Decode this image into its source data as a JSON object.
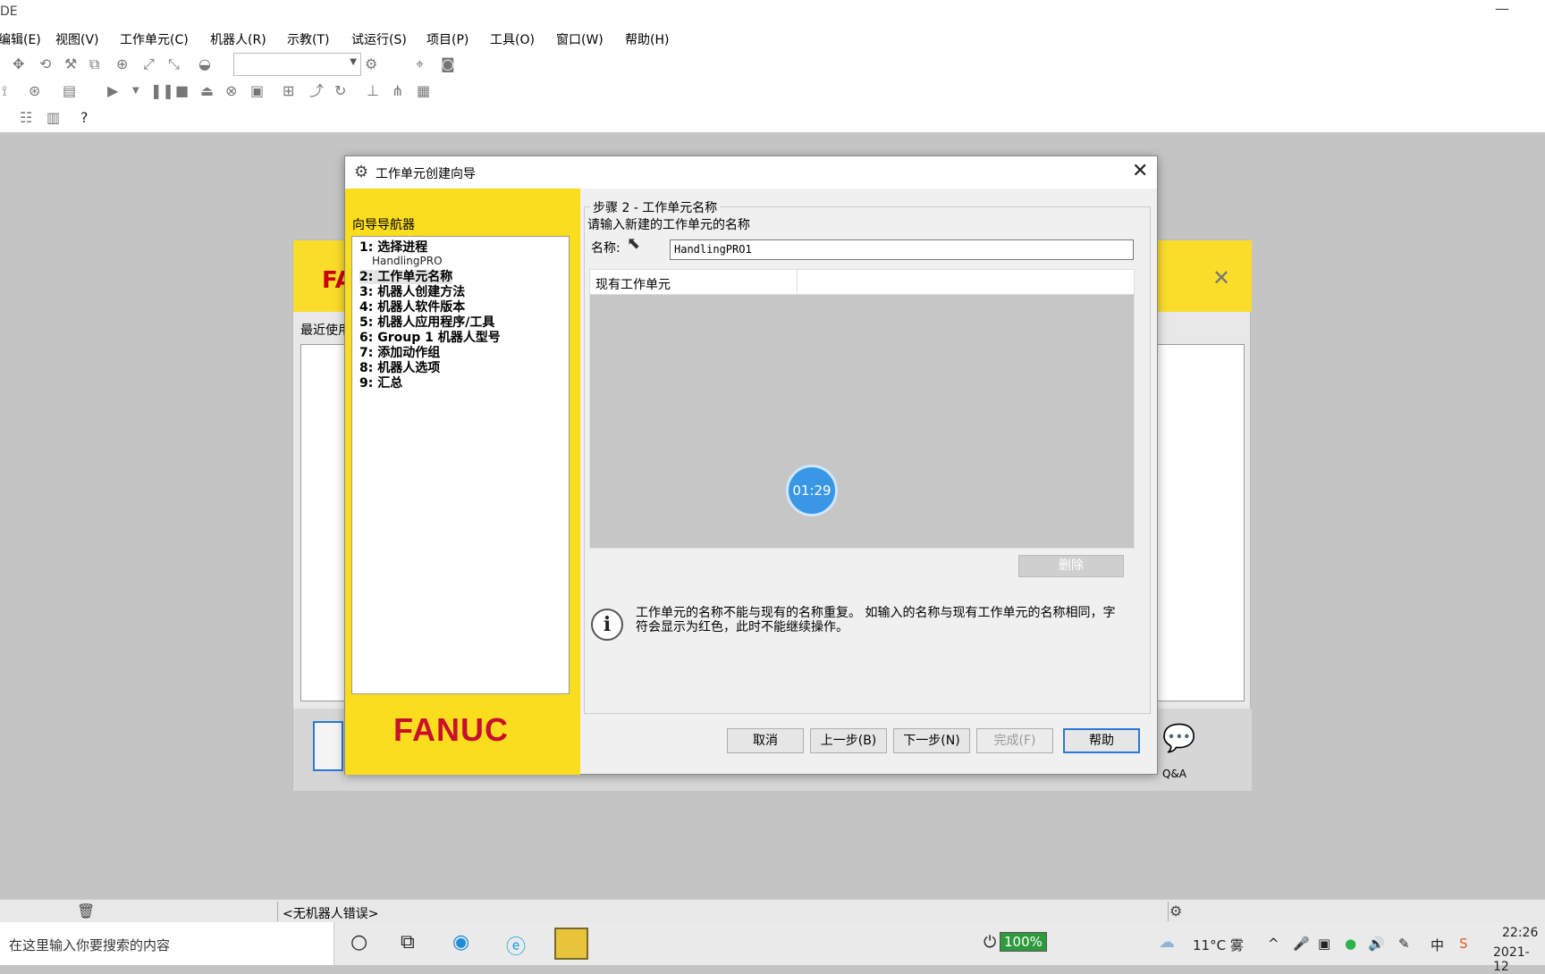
{
  "app": {
    "title_fragment": "DE",
    "minimize": "—"
  },
  "menu": [
    "编辑(E)",
    "视图(V)",
    "工作单元(C)",
    "机器人(R)",
    "示教(T)",
    "试运行(S)",
    "项目(P)",
    "工具(O)",
    "窗口(W)",
    "帮助(H)"
  ],
  "background_window": {
    "logo_fragment": "FA",
    "recent_label": "最近使用",
    "qa_label": "Q&A"
  },
  "dialog": {
    "title": "工作单元创建向导",
    "nav_label": "向导导航器",
    "steps": [
      "1: 选择进程",
      "2: 工作单元名称",
      "3: 机器人创建方法",
      "4: 机器人软件版本",
      "5: 机器人应用程序/工具",
      "6: Group 1 机器人型号",
      "7: 添加动作组",
      "8: 机器人选项",
      "9: 汇总"
    ],
    "step1_value": "HandlingPRO",
    "brand": "FANUC",
    "group_title": "步骤 2 - 工作单元名称",
    "prompt": "请输入新建的工作单元的名称",
    "name_label": "名称:",
    "name_value": "HandlingPRO1",
    "existing_header": "现有工作单元",
    "timer": "01:29",
    "delete_label": "删除",
    "info_text": "工作单元的名称不能与现有的名称重复。  如输入的名称与现有工作单元的名称相同，字符会显示为红色，此时不能继续操作。",
    "buttons": {
      "cancel": "取消",
      "back": "上一步(B)",
      "next": "下一步(N)",
      "finish": "完成(F)",
      "help": "帮助"
    }
  },
  "status_bar": {
    "message": "<无机器人错误>"
  },
  "taskbar": {
    "search_placeholder": "在这里输入你要搜索的内容",
    "battery": "100%",
    "weather": "11°C 雾",
    "ime": "中",
    "time": "22:26",
    "date": "2021-12"
  }
}
